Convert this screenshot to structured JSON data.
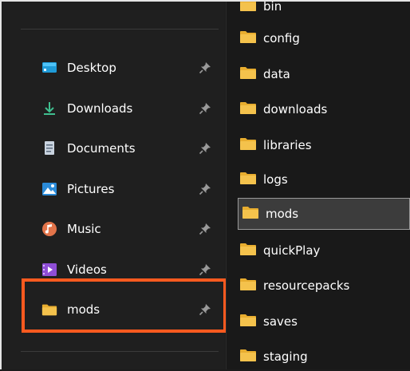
{
  "quick_access": [
    {
      "label": "Desktop",
      "icon": "desktop-icon"
    },
    {
      "label": "Downloads",
      "icon": "download-icon"
    },
    {
      "label": "Documents",
      "icon": "documents-icon"
    },
    {
      "label": "Pictures",
      "icon": "pictures-icon"
    },
    {
      "label": "Music",
      "icon": "music-icon"
    },
    {
      "label": "Videos",
      "icon": "videos-icon"
    },
    {
      "label": "mods",
      "icon": "folder-icon"
    }
  ],
  "folders": [
    {
      "label": "bin"
    },
    {
      "label": "config"
    },
    {
      "label": "data"
    },
    {
      "label": "downloads"
    },
    {
      "label": "libraries"
    },
    {
      "label": "logs"
    },
    {
      "label": "mods",
      "selected": true
    },
    {
      "label": "quickPlay"
    },
    {
      "label": "resourcepacks"
    },
    {
      "label": "saves"
    },
    {
      "label": "staging"
    }
  ],
  "colors": {
    "highlight": "#ff5a1f",
    "folder": "#f4c24c",
    "selection": "#3c3c3c"
  }
}
